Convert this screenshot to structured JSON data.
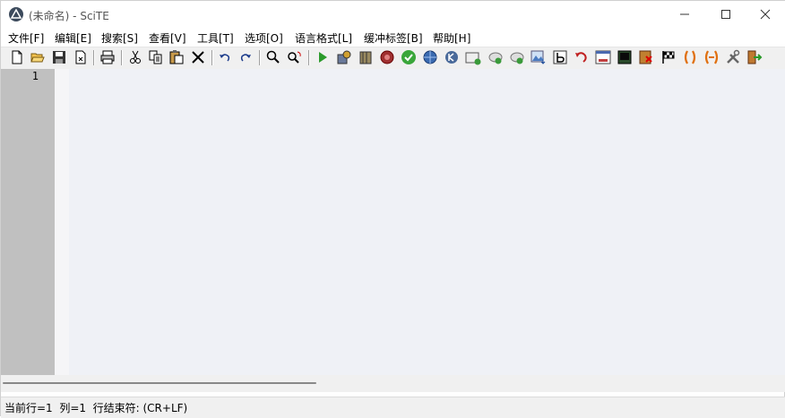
{
  "window": {
    "title": "(未命名) - SciTE"
  },
  "menu": [
    "文件[F]",
    "编辑[E]",
    "搜索[S]",
    "查看[V]",
    "工具[T]",
    "选项[O]",
    "语言格式[L]",
    "缓冲标签[B]",
    "帮助[H]"
  ],
  "toolbar": [
    "new-file-icon",
    "open-folder-icon",
    "save-icon",
    "close-file-icon",
    "print-icon",
    "cut-icon",
    "copy-icon",
    "paste-icon",
    "delete-icon",
    "undo-icon",
    "redo-icon",
    "find-icon",
    "replace-icon",
    "run-icon",
    "compile-icon",
    "build-icon",
    "stop-icon",
    "check-icon",
    "globe-icon",
    "k-icon",
    "add-window-icon",
    "add-cloud-icon",
    "add-cloud2-icon",
    "image-down-icon",
    "bold-b-icon",
    "revert-icon",
    "window-icon",
    "terminal-icon",
    "close-red-icon",
    "flag-icon",
    "paren-icon",
    "paren-minus-icon",
    "tools-icon",
    "exit-icon"
  ],
  "editor": {
    "line_number": "1"
  },
  "status": {
    "text": "当前行=1  列=1  行结束符: (CR+LF)"
  },
  "colors": {
    "editor_bg": "#eff1f6",
    "margin_bg": "#c0c0c0",
    "chrome_bg": "#f0f0f0"
  }
}
